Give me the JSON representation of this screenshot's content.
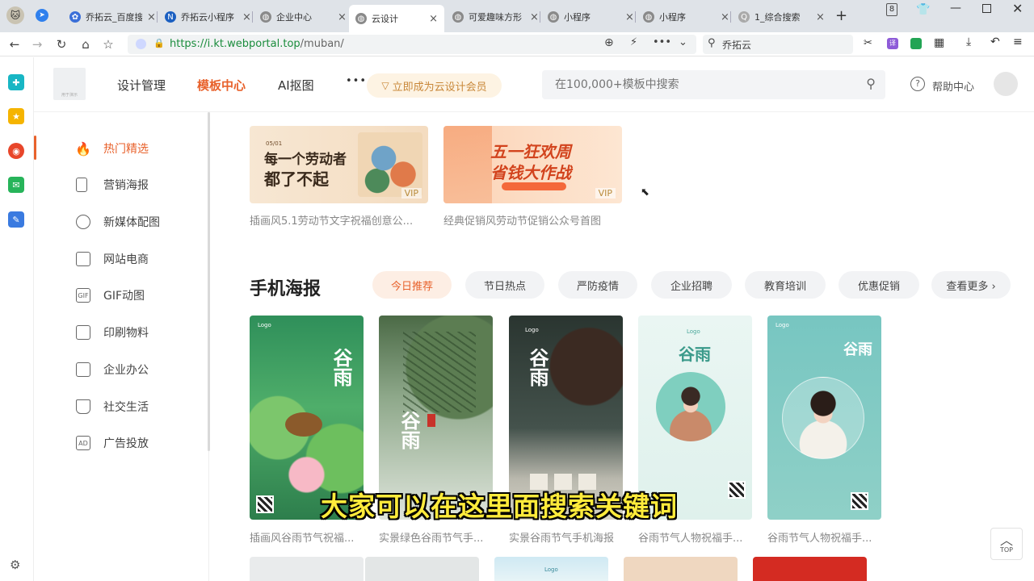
{
  "browser": {
    "tabs": [
      {
        "label": "乔拓云_百度搜索",
        "color": "#3b6fd8",
        "glyph": "✿"
      },
      {
        "label": "乔拓云小程序",
        "color": "#1b5fc1",
        "glyph": "N"
      },
      {
        "label": "企业中心",
        "color": "#777777",
        "glyph": "◍"
      },
      {
        "label": "云设计",
        "color": "#777777",
        "glyph": "◍"
      },
      {
        "label": "可爱趣味方形",
        "color": "#777777",
        "glyph": "◍"
      },
      {
        "label": "小程序",
        "color": "#777777",
        "glyph": "◍"
      },
      {
        "label": "小程序",
        "color": "#777777",
        "glyph": "◍"
      },
      {
        "label": "1_综合搜索",
        "color": "#999999",
        "glyph": "Q"
      }
    ],
    "tab_count": "8",
    "url_host": "https://i.kt.webportal.top",
    "url_path": "/muban/",
    "search_text": "乔拓云"
  },
  "site": {
    "nav": [
      "设计管理",
      "模板中心",
      "AI抠图"
    ],
    "more": "•••",
    "vip_label": "立即成为云设计会员",
    "search_placeholder": "在100,000+模板中搜索",
    "help_label": "帮助中心",
    "logo_text": "用于演示"
  },
  "sidebar": {
    "items": [
      {
        "label": "热门精选",
        "glyph": "🔥"
      },
      {
        "label": "营销海报",
        "glyph": ""
      },
      {
        "label": "新媒体配图",
        "glyph": ""
      },
      {
        "label": "网站电商",
        "glyph": ""
      },
      {
        "label": "GIF动图",
        "glyph": "GIF"
      },
      {
        "label": "印刷物料",
        "glyph": ""
      },
      {
        "label": "企业办公",
        "glyph": ""
      },
      {
        "label": "社交生活",
        "glyph": ""
      },
      {
        "label": "广告投放",
        "glyph": "AD"
      }
    ]
  },
  "banners": [
    {
      "line1": "每一个劳动者",
      "line2": "都了不起",
      "date": "05/01",
      "vip": "VIP",
      "caption": "插画风5.1劳动节文字祝福创意公..."
    },
    {
      "line1": "五一狂欢周",
      "line2": "省钱大作战",
      "date": "",
      "vip": "VIP",
      "caption": "经典促销风劳动节促销公众号首图"
    }
  ],
  "section": {
    "title": "手机海报",
    "chips": [
      "今日推荐",
      "节日热点",
      "严防疫情",
      "企业招聘",
      "教育培训",
      "优惠促销",
      "查看更多 ›"
    ]
  },
  "cards": [
    {
      "title": "谷雨",
      "logo": "Logo",
      "caption": "插画风谷雨节气祝福..."
    },
    {
      "title": "谷雨",
      "logo": "",
      "caption": "实景绿色谷雨节气手..."
    },
    {
      "title": "谷雨",
      "logo": "Logo",
      "caption": "实景谷雨节气手机海报"
    },
    {
      "title": "谷雨",
      "logo": "Logo",
      "caption": "谷雨节气人物祝福手..."
    },
    {
      "title": "谷雨",
      "logo": "Logo",
      "caption": "谷雨节气人物祝福手..."
    }
  ],
  "subtitle": "大家可以在这里面搜索关键词",
  "top_label": "TOP"
}
